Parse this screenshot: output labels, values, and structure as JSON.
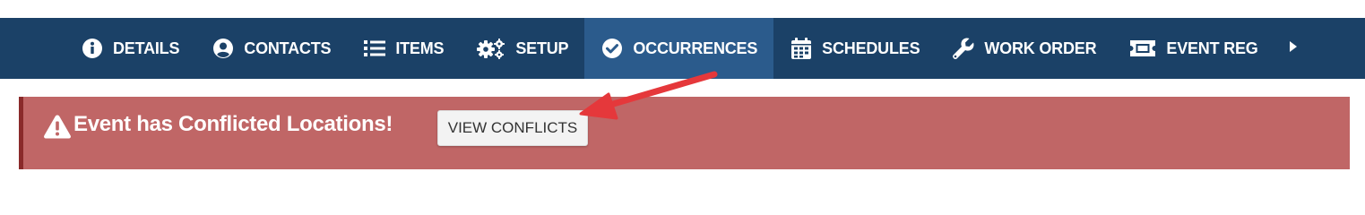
{
  "nav": {
    "tabs": [
      {
        "label": "DETAILS",
        "icon": "info-circle-icon"
      },
      {
        "label": "CONTACTS",
        "icon": "user-circle-icon"
      },
      {
        "label": "ITEMS",
        "icon": "list-icon"
      },
      {
        "label": "SETUP",
        "icon": "gears-icon"
      },
      {
        "label": "OCCURRENCES",
        "icon": "check-circle-icon",
        "active": true
      },
      {
        "label": "SCHEDULES",
        "icon": "calendar-icon"
      },
      {
        "label": "WORK ORDER",
        "icon": "wrench-icon"
      },
      {
        "label": "EVENT REG",
        "icon": "ticket-icon"
      }
    ],
    "more_icon": "caret-right-icon"
  },
  "alert": {
    "title": "Event has Conflicted Locations!",
    "icon": "warning-triangle-icon",
    "button_label": "VIEW CONFLICTS"
  },
  "colors": {
    "navbar": "#1b4167",
    "active_tab": "#2b5b8c",
    "alert_bg": "#c06666",
    "alert_border": "#8a2a2a",
    "annotation_arrow": "#e5383b"
  }
}
